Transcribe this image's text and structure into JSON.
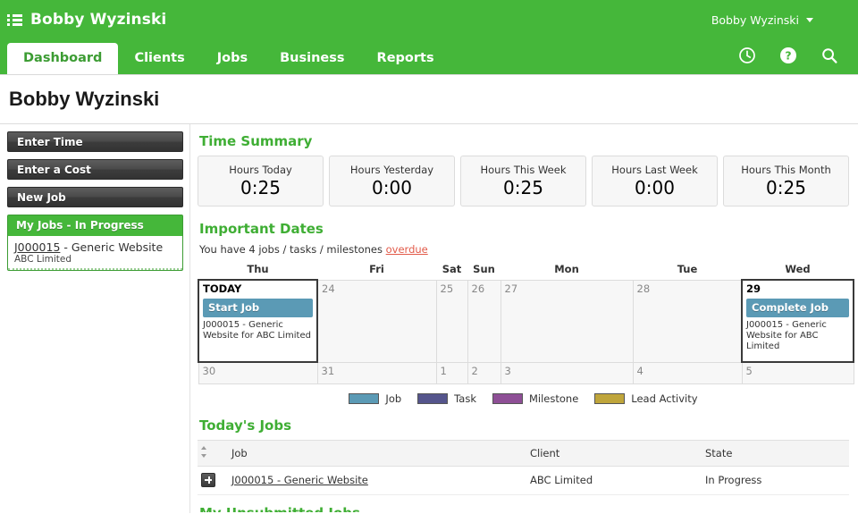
{
  "header": {
    "brand_title": "Bobby Wyzinski",
    "menu_icon": "list-menu-icon",
    "user_name": "Bobby Wyzinski",
    "icons": [
      {
        "name": "recent-items-clock-icon",
        "glyph": "clock"
      },
      {
        "name": "help-icon",
        "glyph": "question-circle"
      },
      {
        "name": "search-icon",
        "glyph": "magnifier"
      }
    ],
    "accent_green": "#45b73a"
  },
  "tabs": [
    {
      "label": "Dashboard",
      "active": true
    },
    {
      "label": "Clients",
      "active": false
    },
    {
      "label": "Jobs",
      "active": false
    },
    {
      "label": "Business",
      "active": false
    },
    {
      "label": "Reports",
      "active": false
    }
  ],
  "page": {
    "title": "Bobby Wyzinski"
  },
  "sidebar": {
    "buttons": [
      {
        "label": "Enter Time"
      },
      {
        "label": "Enter a Cost"
      },
      {
        "label": "New Job"
      }
    ],
    "panel": {
      "title": "My Jobs - In Progress",
      "items": [
        {
          "code": "J000015",
          "separator": " - ",
          "name": "Generic Website",
          "client": "ABC Limited"
        }
      ]
    }
  },
  "time_summary": {
    "title": "Time Summary",
    "cards": [
      {
        "label": "Hours Today",
        "value": "0:25"
      },
      {
        "label": "Hours Yesterday",
        "value": "0:00"
      },
      {
        "label": "Hours This Week",
        "value": "0:25"
      },
      {
        "label": "Hours Last Week",
        "value": "0:00"
      },
      {
        "label": "Hours This Month",
        "value": "0:25"
      }
    ]
  },
  "important_dates": {
    "title": "Important Dates",
    "overdue_prefix": "You have 4 jobs / tasks / milestones ",
    "overdue_link": "overdue",
    "day_headers": [
      "Thu",
      "Fri",
      "Sat",
      "Sun",
      "Mon",
      "Tue",
      "Wed"
    ],
    "week1": [
      {
        "daynum": "TODAY",
        "today": true,
        "event": {
          "label": "Start Job",
          "desc": "J000015 - Generic Website for ABC Limited",
          "color": "#5b9ab5"
        }
      },
      {
        "daynum": "24",
        "today": false,
        "event": null
      },
      {
        "daynum": "25",
        "today": false,
        "event": null
      },
      {
        "daynum": "26",
        "today": false,
        "event": null
      },
      {
        "daynum": "27",
        "today": false,
        "event": null
      },
      {
        "daynum": "28",
        "today": false,
        "event": null
      },
      {
        "daynum": "29",
        "today": false,
        "event": {
          "label": "Complete Job",
          "desc": "J000015 - Generic Website for ABC Limited",
          "color": "#5b9ab5"
        }
      }
    ],
    "week2": [
      {
        "daynum": "30"
      },
      {
        "daynum": "31"
      },
      {
        "daynum": "1"
      },
      {
        "daynum": "2"
      },
      {
        "daynum": "3"
      },
      {
        "daynum": "4"
      },
      {
        "daynum": "5"
      }
    ],
    "legend": [
      {
        "label": "Job",
        "color": "#5b9ab5"
      },
      {
        "label": "Task",
        "color": "#55558c"
      },
      {
        "label": "Milestone",
        "color": "#8e4f96"
      },
      {
        "label": "Lead Activity",
        "color": "#bfa53b"
      }
    ]
  },
  "todays_jobs": {
    "title": "Today's Jobs",
    "columns": [
      "",
      "Job",
      "Client",
      "State"
    ],
    "sort_icon": "sort-arrows-icon",
    "rows": [
      {
        "expand": "expand-row-icon",
        "job": "J000015 - Generic Website",
        "client": "ABC Limited",
        "state": "In Progress"
      }
    ]
  },
  "clipped_section": {
    "title": "My Unsubmitted Jobs"
  }
}
